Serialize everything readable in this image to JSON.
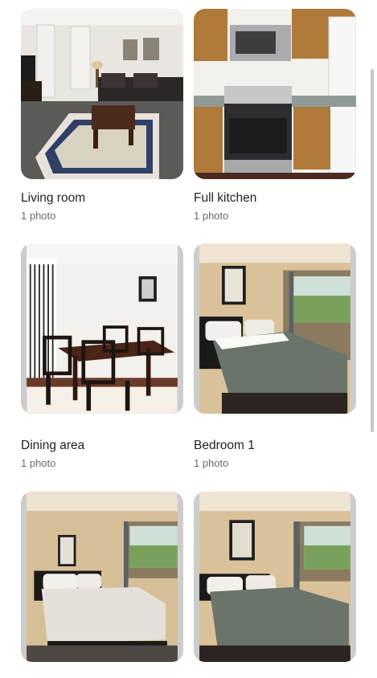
{
  "rooms": [
    {
      "title": "Living room",
      "count": "1 photo",
      "image": "living-room-photo"
    },
    {
      "title": "Full kitchen",
      "count": "1 photo",
      "image": "kitchen-photo"
    },
    {
      "title": "Dining area",
      "count": "1 photo",
      "image": "dining-area-photo"
    },
    {
      "title": "Bedroom 1",
      "count": "1 photo",
      "image": "bedroom-1-photo"
    },
    {
      "title": "",
      "count": "",
      "image": "bedroom-2-photo"
    },
    {
      "title": "",
      "count": "",
      "image": "bedroom-3-photo"
    }
  ]
}
